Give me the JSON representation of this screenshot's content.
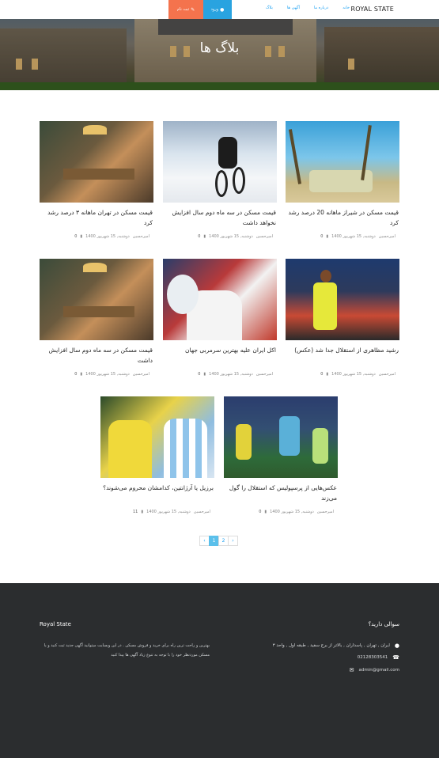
{
  "nav": {
    "brand": "ROYAL STATE",
    "links": [
      "خانه",
      "درباره ما",
      "آگهی ها",
      "بلاگ"
    ],
    "login": "ورود",
    "register": "ثبت نام"
  },
  "hero": {
    "title": "بلاگ ها"
  },
  "posts": [
    {
      "title": "قیمت مسکن در شیراز ماهانه 20 درصد رشد کرد",
      "author": "امیرحسین",
      "date": "دوشنبه, 15 شهریور 1400",
      "comments": "0"
    },
    {
      "title": "قیمت مسکن در سه ماه دوم سال افزایش نخواهد داشت",
      "author": "امیرحسین",
      "date": "دوشنبه, 15 شهریور 1400",
      "comments": "0"
    },
    {
      "title": "قیمت مسکن در تهران ماهانه ۳ درصد رشد کرد",
      "author": "امیرحسین",
      "date": "دوشنبه, 15 شهریور 1400",
      "comments": "0"
    },
    {
      "title": "رشید مظاهری از استقلال جدا شد (عکس)",
      "author": "امیرحسین",
      "date": "دوشنبه, 15 شهریور 1400",
      "comments": "0"
    },
    {
      "title": "اکل ایران علیه بهترین سرمربی جهان",
      "author": "امیرحسین",
      "date": "دوشنبه, 15 شهریور 1400",
      "comments": "0"
    },
    {
      "title": "قیمت مسکن در سه ماه دوم سال افزایش داشت",
      "author": "امیرحسین",
      "date": "دوشنبه, 15 شهریور 1400",
      "comments": "0"
    },
    {
      "title": "عکس‌هایی از پرسپولیس که استقلال را گول می‌زند",
      "author": "امیرحسین",
      "date": "دوشنبه, 15 شهریور 1400",
      "comments": "0"
    },
    {
      "title": "برزیل یا آرژانتین، کدامشان محروم می‌شوند؟",
      "author": "امیرحسین",
      "date": "دوشنبه, 15 شهریور 1400",
      "comments": "11"
    }
  ],
  "pagination": {
    "prev": "‹",
    "pages": [
      "1",
      "2"
    ],
    "next": "›"
  },
  "footer": {
    "brand": "Royal State",
    "description": "بهترین و راحت ترین راه برای خرید و فروش مسکن . در این وبسایت میتوانید آگهی جدید ثبت کنید و یا مسکن موردنظر خود را با توجه به تنوع زیاد آگهی ها پیدا کنید",
    "question": "سوالی دارید؟",
    "address": "ایران , تهران , پاسداران , بالاتر از برج سفید , طبقه اول , واحد ۳",
    "phone": "02128303541",
    "email": "admin@gmail.com"
  },
  "colors": {
    "login_bg": "#29a3e0",
    "register_bg": "#f4734d",
    "footer_bg": "#2b2d2f",
    "link": "#1da1f2"
  },
  "icons": {
    "login": "user-icon",
    "register": "pencil-icon",
    "comment": "comment-icon",
    "address": "map-marker-icon",
    "phone": "phone-icon",
    "email": "envelope-icon"
  }
}
